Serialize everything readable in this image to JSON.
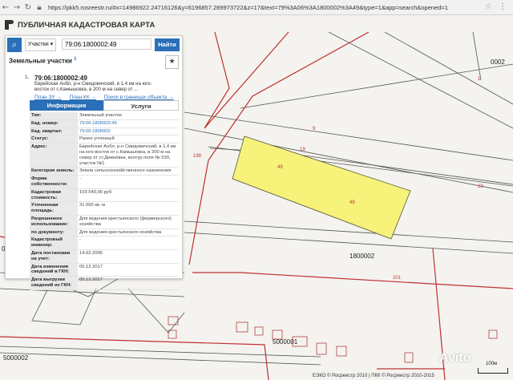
{
  "browser": {
    "url": "https://pkk5.rosreestr.ru/#x=14986922.24716126&y=6196857.289973722&z=17&text=79%3A06%3A1800002%3A49&type=1&app=search&opened=1"
  },
  "app": {
    "title": "ПУБЛИЧНАЯ КАДАСТРОВАЯ КАРТА"
  },
  "search": {
    "type_label": "Участки",
    "query": "79:06:1800002:49",
    "button_label": "Найти"
  },
  "results": {
    "section_title": "Земельные участки",
    "count": "1",
    "item": {
      "index": "1.",
      "cad_number": "79:06:1800002:49",
      "address_short": "Еврейская Аобл, р-н Смидовичский, в 1,4 км на юго-восток от с.Камышовка, в 200 м на север от ...",
      "links": [
        "План ЗУ →",
        "План КК →",
        "Поиск в границах объекта →"
      ]
    },
    "tabs": [
      "Информация",
      "Услуги"
    ],
    "info": [
      {
        "label": "Тип:",
        "value": "Земельный участок"
      },
      {
        "label": "Кад. номер:",
        "value": "79:06:1800002:49"
      },
      {
        "label": "Кад. квартал:",
        "value": "79:06:1800002"
      },
      {
        "label": "Статус:",
        "value": "Ранее учтенный"
      },
      {
        "label": "Адрес:",
        "value": "Еврейская Аобл, р-н Смидовичский, в 1,4 км на юго-восток от с.Камышовка, в 200 м на север от ст.Дежнёвка, контур поля № 530, участок №1"
      },
      {
        "label": "Категория земель:",
        "value": "Земли сельскохозяйственного назначения"
      },
      {
        "label": "Форма собственности:",
        "value": "-"
      },
      {
        "label": "Кадастровая стоимость:",
        "value": "103 540,00 руб."
      },
      {
        "label": "Уточненная площадь:",
        "value": "31 000 кв. м"
      },
      {
        "label": "Разрешенное использование:",
        "value": "Для ведения крестьянского (фермерского) хозяйства"
      },
      {
        "label": "по документу:",
        "value": "Для ведения крестьянского хозяйства"
      },
      {
        "label": "Кадастровый инженер:",
        "value": "-"
      },
      {
        "label": "Дата постановки на учет:",
        "value": "14.02.2005"
      },
      {
        "label": "Дата изменения сведений в ГКН:",
        "value": "05.12.2017"
      },
      {
        "label": "Дата выгрузки сведений из ГКН:",
        "value": "05.12.2017"
      }
    ]
  },
  "map": {
    "parcel_labels": [
      "49",
      "49"
    ],
    "quarter_labels": [
      "1800002",
      "5000001",
      "5000002",
      "0001",
      "0002"
    ],
    "lot_labels": [
      "199",
      "9",
      "19",
      "19",
      "201",
      "41",
      "1"
    ],
    "highlight_color": "#f6f27a"
  },
  "footer": {
    "credits": "ЕЭКО © Росреестр 2010 | ПКК © Росреестр 2010-2015",
    "scale": "100м"
  },
  "watermark": "Avito"
}
